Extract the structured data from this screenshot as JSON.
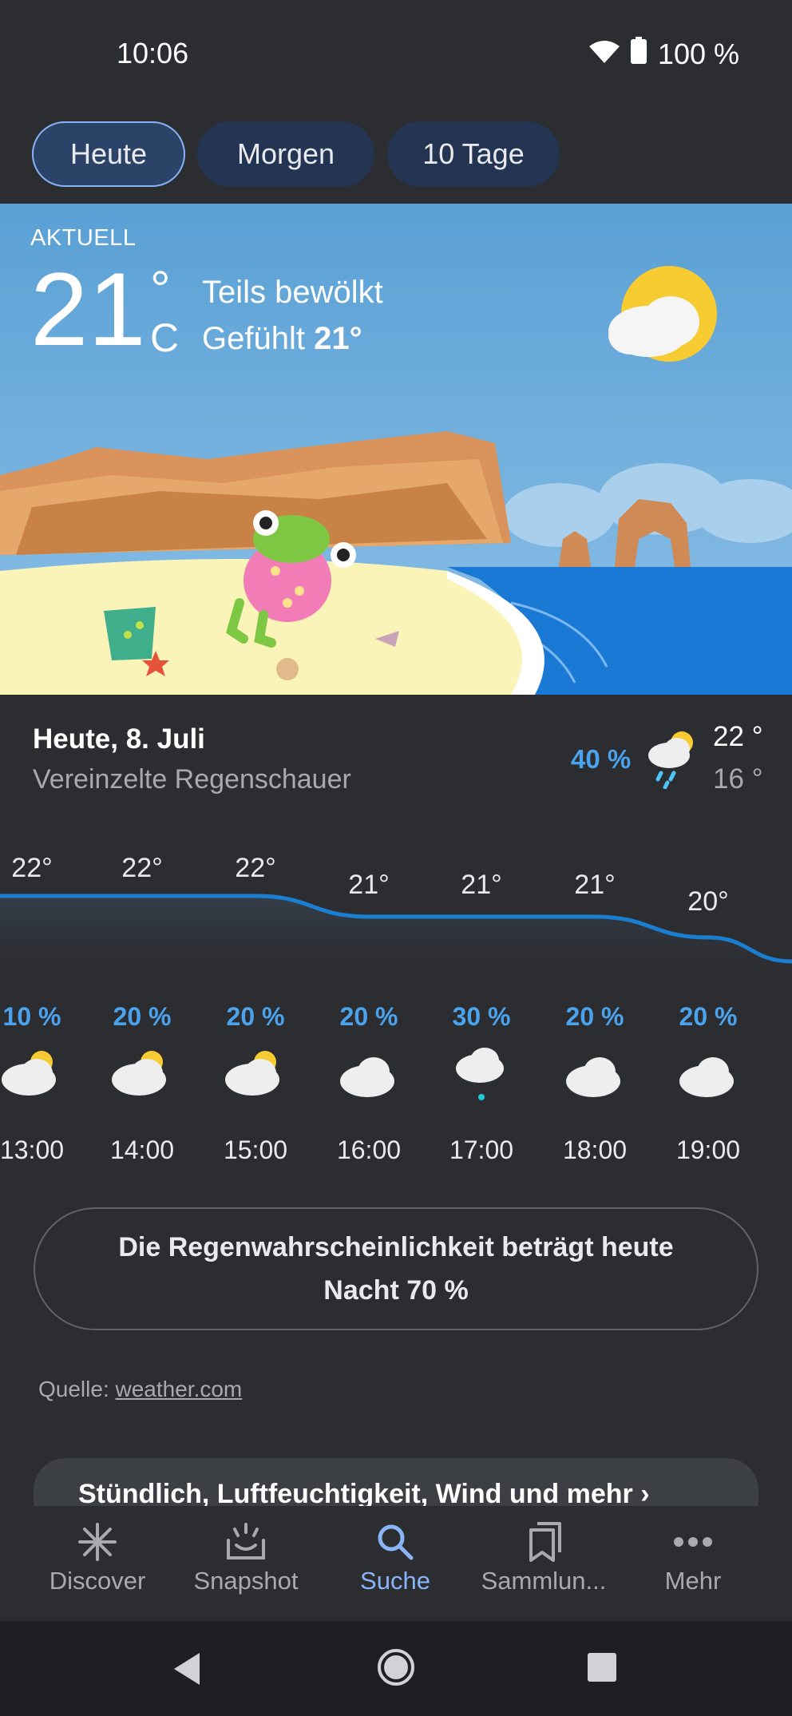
{
  "status_bar": {
    "time": "10:06",
    "battery": "100 %"
  },
  "tabs": [
    {
      "label": "Heute",
      "active": true
    },
    {
      "label": "Morgen",
      "active": false
    },
    {
      "label": "10 Tage",
      "active": false
    }
  ],
  "current": {
    "label": "AKTUELL",
    "temperature": "21",
    "degree": "°",
    "unit": "C",
    "condition": "Teils bewölkt",
    "feels_prefix": "Gefühlt ",
    "feels_value": "21°"
  },
  "day_summary": {
    "title": "Heute, 8. Juli",
    "subtitle": "Vereinzelte Regenschauer",
    "precip": "40 %",
    "high": "22 °",
    "low": "16 °"
  },
  "hourly": [
    {
      "time": "13:00",
      "temp": "22°",
      "precip": "10 %",
      "icon": "sun-cloud-icon"
    },
    {
      "time": "14:00",
      "temp": "22°",
      "precip": "20 %",
      "icon": "sun-cloud-icon"
    },
    {
      "time": "15:00",
      "temp": "22°",
      "precip": "20 %",
      "icon": "sun-cloud-icon"
    },
    {
      "time": "16:00",
      "temp": "21°",
      "precip": "20 %",
      "icon": "cloud-icon"
    },
    {
      "time": "17:00",
      "temp": "21°",
      "precip": "30 %",
      "icon": "cloud-rain-icon"
    },
    {
      "time": "18:00",
      "temp": "21°",
      "precip": "20 %",
      "icon": "cloud-icon"
    },
    {
      "time": "19:00",
      "temp": "20°",
      "precip": "20 %",
      "icon": "cloud-icon"
    }
  ],
  "rain_message": "Die Regenwahrscheinlichkeit beträgt heute Nacht 70 %",
  "source": {
    "prefix": "Quelle: ",
    "link": "weather.com"
  },
  "more_card": {
    "label": "Stündlich, Luftfeuchtigkeit, Wind und mehr"
  },
  "bottom_nav": [
    {
      "label": "Discover",
      "icon": "asterisk-icon",
      "active": false
    },
    {
      "label": "Snapshot",
      "icon": "snapshot-icon",
      "active": false
    },
    {
      "label": "Suche",
      "icon": "search-icon",
      "active": true
    },
    {
      "label": "Sammlun...",
      "icon": "bookmarks-icon",
      "active": false
    },
    {
      "label": "Mehr",
      "icon": "more-dots-icon",
      "active": false
    }
  ],
  "colors": {
    "accent": "#8ab4f8",
    "precip": "#4aa3ec",
    "background": "#2c2d31"
  }
}
